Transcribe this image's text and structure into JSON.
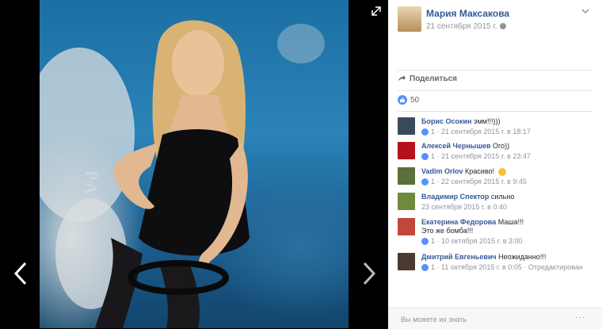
{
  "post": {
    "author": "Мария Максакова",
    "date": "21 сентября 2015 г."
  },
  "actions": {
    "share_label": "Поделиться"
  },
  "likes": {
    "count": "50"
  },
  "comments": [
    {
      "name": "Борис Осокин",
      "text": "эмм!!!)))",
      "meta": "1 · 21 сентября 2015 г. в 18:17",
      "avatar_color": "#3a4a5a"
    },
    {
      "name": "Алексей Чернышев",
      "text": "Ого))",
      "meta": "1 · 21 сентября 2015 г. в 23:47",
      "avatar_color": "#b3121b"
    },
    {
      "name": "Vadim Orlov",
      "text": "Красиво! ",
      "meta": "1 · 22 сентября 2015 г. в 9:45",
      "avatar_color": "#5b6f3a"
    },
    {
      "name": "Владимир Спектор",
      "text": "сильно",
      "meta": "23 сентября 2015 г. в 0:40",
      "avatar_color": "#6f8a3c"
    },
    {
      "name": "Екатерина Федорова",
      "text": "Маша!!!",
      "text2": "Это же бомба!!!",
      "meta": "1 · 10 октября 2015 г. в 3:00",
      "avatar_color": "#c0473a"
    },
    {
      "name": "Дмитрий Евгеньевич",
      "text": "Неожиданно!!!",
      "meta": "1 · 11 октября 2015 г. в 0:05 · Отредактирован",
      "avatar_color": "#4a3a30"
    }
  ],
  "footer": {
    "text": "Вы можете их знать",
    "more": "···"
  },
  "photo": {
    "wall_text": "PA"
  },
  "icons": {
    "prev": "chevron-left-icon",
    "next": "chevron-right-icon",
    "expand": "expand-icon",
    "menu": "chevron-down-icon",
    "share": "share-arrow-icon",
    "like": "like-icon",
    "privacy": "globe-icon"
  },
  "colors": {
    "link": "#365899",
    "like_blue": "#5890ff",
    "meta_gray": "#90949c"
  }
}
